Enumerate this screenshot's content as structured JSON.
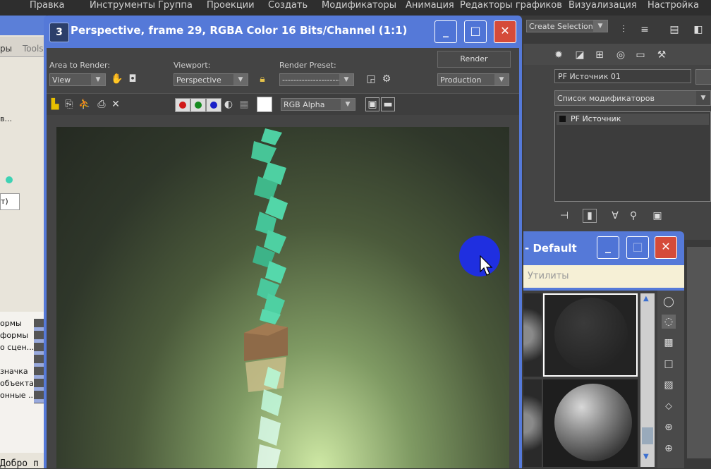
{
  "app_menu": {
    "items": [
      "Правка",
      "Инструменты",
      "Группа",
      "Проекции",
      "Создать",
      "Модификаторы",
      "Анимация",
      "Редакторы графиков",
      "Визуализация",
      "Настройка"
    ]
  },
  "left_window": {
    "tab_label": "Tools",
    "side_label": "ры",
    "list_items": [
      "ормы",
      "формы",
      "о сцен...",
      "значка",
      "объекта",
      "онные ..."
    ],
    "snippets": [
      "в...",
      "т)"
    ],
    "bottom_text": "Добро п"
  },
  "render_window": {
    "title": "Perspective, frame 29, RGBA Color 16 Bits/Channel (1:1)",
    "area_to_render_label": "Area to Render:",
    "area_value": "View",
    "viewport_label": "Viewport:",
    "viewport_value": "Perspective",
    "render_preset_label": "Render Preset:",
    "render_preset_value": "---------------------",
    "render_button": "Render",
    "production_value": "Production",
    "channel_value": "RGB Alpha"
  },
  "command_panel": {
    "selection_set": "Create Selection",
    "object_name": "PF Источник 01",
    "modifier_list": "Список модификаторов",
    "stack_item": "PF Источник"
  },
  "material_window": {
    "title": "- Default",
    "tab_label": "Утилиты"
  },
  "colors": {
    "titlebar": "#5579d8",
    "close_button": "#d54b3a",
    "panel": "#444444",
    "particles": "#4ed0a2",
    "cursor_highlight": "#1f2fe0"
  }
}
